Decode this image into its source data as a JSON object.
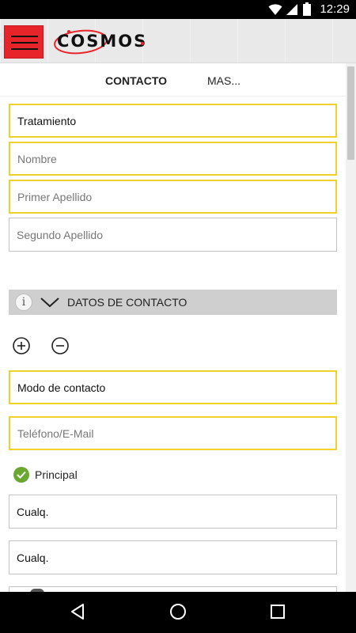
{
  "status_bar": {
    "time": "12:29",
    "icons": [
      "wifi-icon",
      "signal-icon",
      "battery-icon"
    ]
  },
  "header": {
    "logo_text": "COSMOS",
    "brand_color": "#e8242b"
  },
  "tabs": [
    {
      "label": "CONTACTO",
      "active": true
    },
    {
      "label": "MAS...",
      "active": false
    }
  ],
  "form": {
    "tratamiento": "Tratamiento",
    "nombre_placeholder": "Nombre",
    "primer_apellido_placeholder": "Primer Apellido",
    "segundo_apellido_placeholder": "Segundo Apellido"
  },
  "contact_section": {
    "title": "DATOS DE CONTACTO",
    "modo_contacto": "Modo de contacto",
    "telefono_placeholder": "Teléfono/E-Mail",
    "principal_label": "Principal",
    "select_1": "Cualq.",
    "select_2": "Cualq."
  },
  "colors": {
    "required_border": "#f2d02a",
    "check_green": "#6aa832",
    "section_bar": "#cfcfcf"
  }
}
